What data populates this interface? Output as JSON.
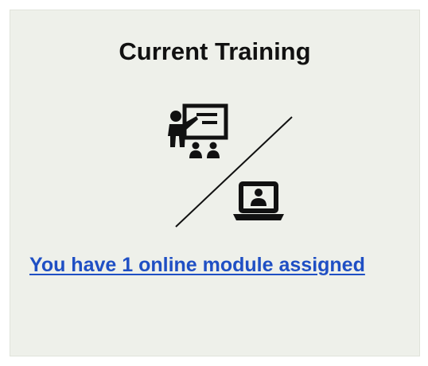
{
  "card": {
    "title": "Current Training",
    "link_text": "You have 1 online module assigned"
  },
  "icons": {
    "classroom": "teacher-presenting-icon",
    "online": "laptop-user-icon"
  },
  "colors": {
    "background": "#eef0ea",
    "title": "#111111",
    "link": "#1f4fc4"
  }
}
